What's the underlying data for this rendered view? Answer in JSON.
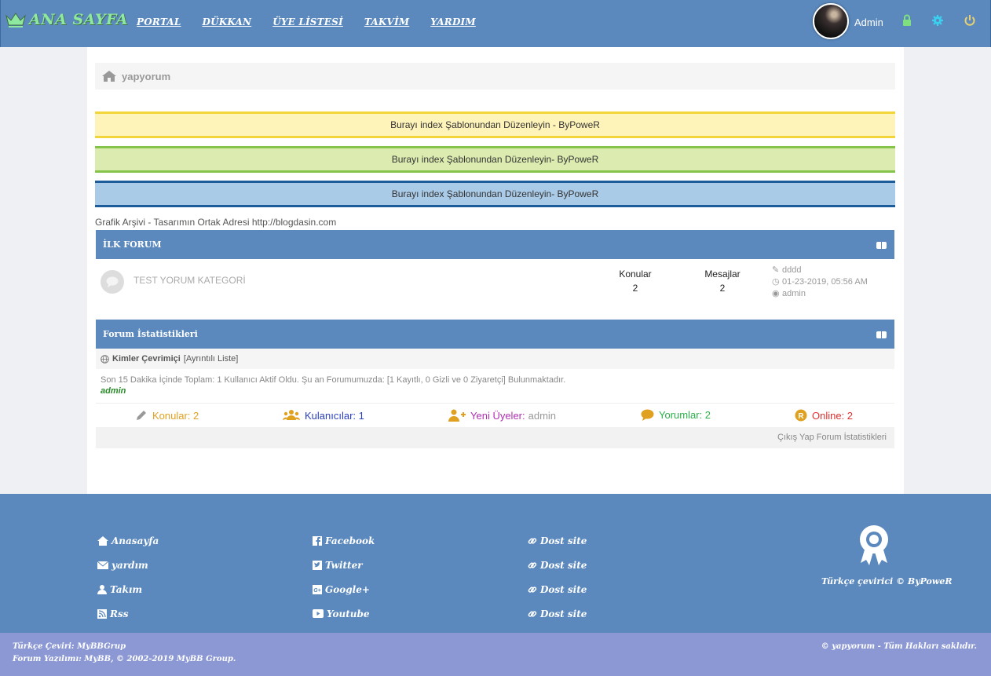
{
  "header": {
    "logo_text": "ANA SAYFA",
    "nav": [
      "PORTAL",
      "DÜKKAN",
      "ÜYE LİSTESİ",
      "TAKVİM",
      "YARDIM"
    ],
    "user_name": "Admin",
    "accent_color": "#5b89bd",
    "logo_color": "#8fe8a0"
  },
  "breadcrumb": {
    "home_text": "yapyorum"
  },
  "notices": [
    "Burayı index Şablonundan Düzenleyin - ByPoweR",
    "Burayı index Şablonundan Düzenleyin- ByPoweR",
    "Burayı index Şablonundan Düzenleyin- ByPoweR"
  ],
  "credit_line": "Grafik Arşivi - Tasarımın Ortak Adresi http://blogdasin.com",
  "category": {
    "title": "İLK FORUM",
    "forum_name": "TEST YORUM KATEGORİ",
    "threads_label": "Konular",
    "threads_value": "2",
    "posts_label": "Mesajlar",
    "posts_value": "2",
    "last_post_title": "dddd",
    "last_post_date": "01-23-2019, 05:56 AM",
    "last_post_user": "admin"
  },
  "stats": {
    "title": "Forum İstatistikleri",
    "who_online_label": "Kimler Çevrimiçi",
    "who_online_link": "[Ayrıntılı Liste]",
    "who_online_text": "Son 15 Dakika İçinde Toplam: 1 Kullanıcı Aktif Oldu. Şu an Forumumuzda: [1 Kayıtlı, 0 Gizli ve 0 Ziyaretçi] Bulunmaktadır.",
    "online_user": "admin",
    "threads": "Konular: 2",
    "users": "Kulanıcılar: 1",
    "new_members_label": "Yeni Üyeler:",
    "new_member": "admin",
    "comments": "Yorumlar: 2",
    "online": "Online: 2",
    "footer_link": "Çıkış Yap Forum İstatistikleri"
  },
  "footer": {
    "col1": [
      "Anasayfa",
      "yardım",
      "Takım",
      "Rss"
    ],
    "col2": [
      "Facebook",
      "Twitter",
      "Google+",
      "Youtube"
    ],
    "col3": [
      "Dost site",
      "Dost site",
      "Dost site",
      "Dost site"
    ],
    "translation_credit": "Türkçe çevirici © ByPoweR"
  },
  "bottom": {
    "line1": "Türkçe Çeviri: MyBBGrup",
    "line2": "Forum Yazılımı: MyBB, © 2002-2019 MyBB Group.",
    "right": "© yapyorum - Tüm Hakları saklıdır."
  }
}
